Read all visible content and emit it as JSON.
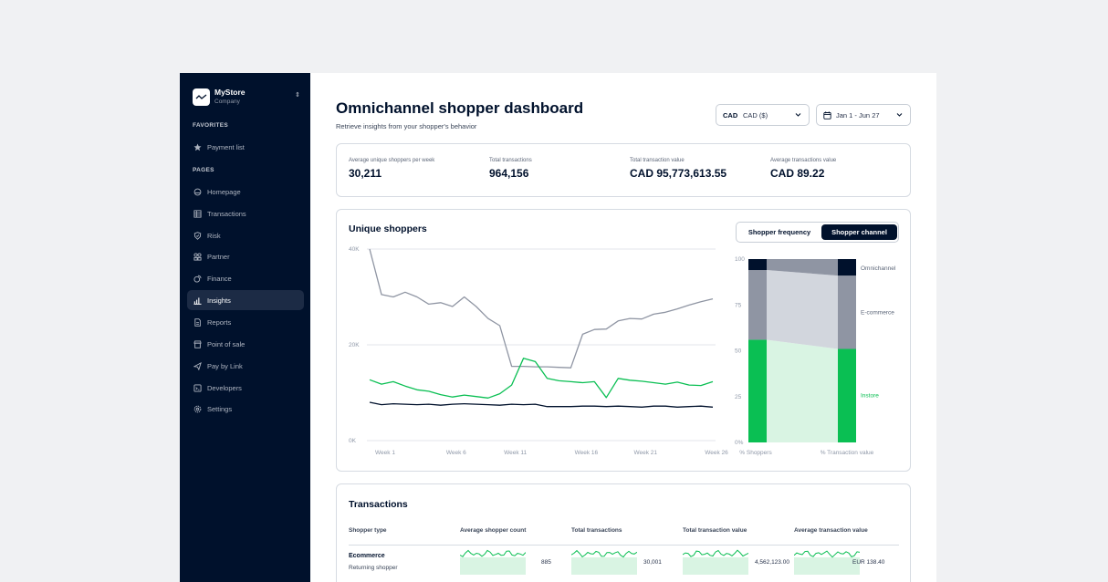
{
  "brand": {
    "name": "MyStore",
    "subtitle": "Company"
  },
  "sidebar": {
    "favorites_label": "FAVORITES",
    "favorites": [
      {
        "label": "Payment list",
        "icon": "star-icon"
      }
    ],
    "pages_label": "PAGES",
    "pages": [
      {
        "label": "Homepage",
        "icon": "home-icon"
      },
      {
        "label": "Transactions",
        "icon": "table-icon"
      },
      {
        "label": "Risk",
        "icon": "shield-icon"
      },
      {
        "label": "Partner",
        "icon": "partner-icon"
      },
      {
        "label": "Finance",
        "icon": "coins-icon"
      },
      {
        "label": "Insights",
        "icon": "bar-chart-icon",
        "active": true
      },
      {
        "label": "Reports",
        "icon": "report-icon"
      },
      {
        "label": "Point of sale",
        "icon": "store-icon"
      },
      {
        "label": "Pay by Link",
        "icon": "send-icon"
      },
      {
        "label": "Developers",
        "icon": "code-icon"
      },
      {
        "label": "Settings",
        "icon": "gear-icon"
      }
    ]
  },
  "header": {
    "title": "Omnichannel shopper dashboard",
    "subtitle": "Retrieve insights from your shopper's behavior",
    "currency_code": "CAD",
    "currency_value": "CAD ($)",
    "date_range": "Jan 1 - Jun 27"
  },
  "kpis": [
    {
      "label": "Average unique shoppers per week",
      "value": "30,211"
    },
    {
      "label": "Total transactions",
      "value": "964,156"
    },
    {
      "label": "Total transaction value",
      "value": "CAD 95,773,613.55"
    },
    {
      "label": "Average transactions value",
      "value": "CAD 89.22"
    }
  ],
  "unique_shoppers": {
    "title": "Unique shoppers",
    "toggle": {
      "frequency": "Shopper frequency",
      "channel": "Shopper channel",
      "selected": "channel"
    }
  },
  "colors": {
    "navy": "#00112c",
    "green": "#0abf53",
    "grey": "#8f95a3",
    "light_green": "#d9f4e3",
    "light_grey": "#d2d6dd"
  },
  "chart_data": [
    {
      "type": "line",
      "title": "Unique shoppers",
      "ylim": [
        0,
        40000
      ],
      "y_ticks": [
        "0K",
        "20K",
        "40K"
      ],
      "x_ticks": [
        "Week 1",
        "Week 6",
        "Week 11",
        "Week 16",
        "Week 21",
        "Week 26"
      ],
      "x": [
        1,
        2,
        3,
        4,
        5,
        6,
        7,
        8,
        9,
        10,
        11,
        12,
        13,
        14,
        15,
        16,
        17,
        18,
        19,
        20,
        21,
        22,
        23,
        24,
        25,
        26,
        27,
        28,
        29,
        30
      ],
      "series": [
        {
          "color": "#8f95a3",
          "values": [
            40000,
            30500,
            30000,
            31000,
            30000,
            28500,
            28800,
            28000,
            30000,
            28000,
            25500,
            24000,
            15500,
            15500,
            15400,
            15400,
            15300,
            15200,
            22200,
            23200,
            23300,
            25000,
            25500,
            25400,
            26400,
            26800,
            27500,
            28300,
            29000,
            29600
          ]
        },
        {
          "color": "#0abf53",
          "values": [
            12700,
            11800,
            12300,
            11400,
            10600,
            10300,
            9600,
            9100,
            9500,
            9200,
            8900,
            9800,
            11600,
            17200,
            16500,
            13000,
            12500,
            12300,
            12100,
            12300,
            9000,
            13000,
            12600,
            12400,
            12100,
            11800,
            12200,
            11600,
            11500,
            12300
          ]
        },
        {
          "color": "#00112c",
          "values": [
            8000,
            7500,
            7700,
            7600,
            7500,
            7600,
            7400,
            7600,
            7700,
            7600,
            7500,
            7400,
            7600,
            7500,
            7600,
            7100,
            7100,
            7100,
            7200,
            7200,
            7100,
            7200,
            7100,
            7000,
            7200,
            7200,
            7000,
            7100,
            7200,
            7000
          ]
        }
      ]
    },
    {
      "type": "bar",
      "stacked": true,
      "categories": [
        "% Shoppers",
        "% Transaction value"
      ],
      "ylim": [
        0,
        100
      ],
      "y_ticks": [
        "0%",
        "25",
        "50",
        "75",
        "100"
      ],
      "series": [
        {
          "name": "Instore",
          "color": "#0abf53",
          "values": [
            56,
            51
          ]
        },
        {
          "name": "E-commerce",
          "color": "#8f95a3",
          "values": [
            38,
            40
          ]
        },
        {
          "name": "Omnichannel",
          "color": "#00112c",
          "values": [
            6,
            9
          ]
        }
      ]
    }
  ],
  "transactions": {
    "title": "Transactions",
    "headers": [
      "Shopper type",
      "Average shopper count",
      "Total transactions",
      "Total transaction value",
      "Average transaction value"
    ],
    "rows": [
      {
        "type": "Ecommerce",
        "subtype": "Returning shopper",
        "values": [
          "885",
          "30,001",
          "4,562,123.00",
          "EUR 138.40"
        ]
      }
    ]
  }
}
